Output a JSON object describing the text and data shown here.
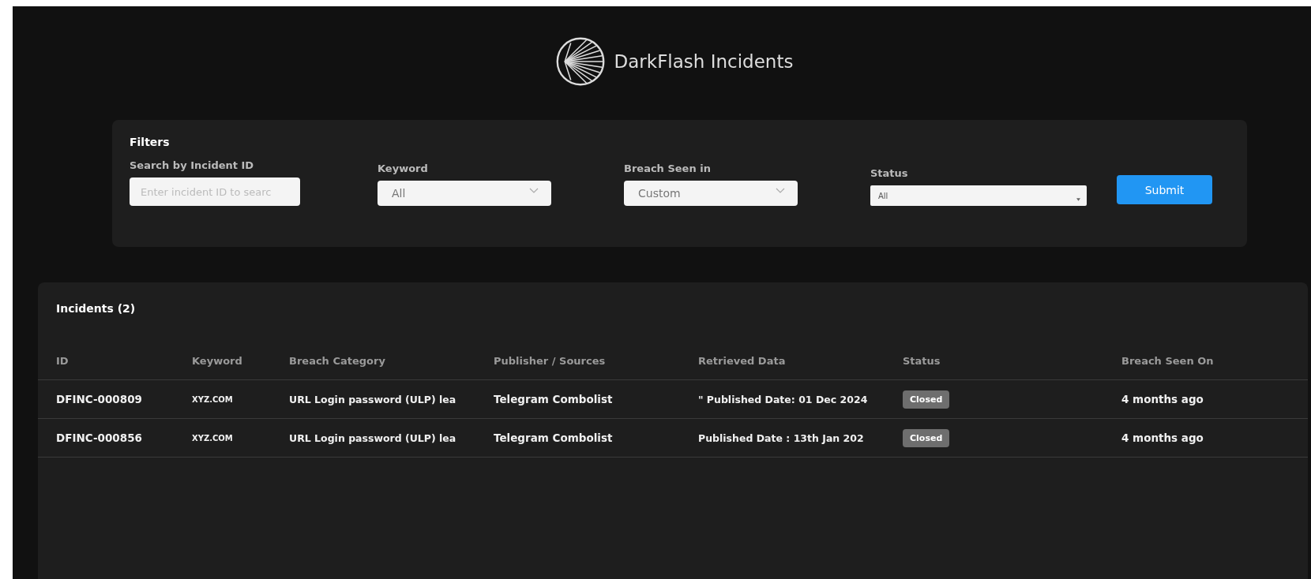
{
  "header": {
    "title": "DarkFlash Incidents"
  },
  "filters": {
    "title": "Filters",
    "fields": [
      {
        "kind": "text",
        "label": "Search by Incident ID",
        "placeholder": "Enter incident ID to searc"
      },
      {
        "kind": "select",
        "label": "Keyword",
        "value": "All"
      },
      {
        "kind": "select",
        "label": "Breach Seen in",
        "value": "Custom"
      },
      {
        "kind": "small-select",
        "label": "Status",
        "value": "All"
      }
    ],
    "submit": "Submit"
  },
  "incidents": {
    "title": "Incidents (2)",
    "columns": [
      "ID",
      "Keyword",
      "Breach Category",
      "Publisher / Sources",
      "Retrieved Data",
      "Status",
      "Breach Seen On"
    ],
    "rows": [
      {
        "id": "DFINC-000809",
        "keyword": "XYZ.COM",
        "category": "URL Login password (ULP) lea",
        "source": "Telegram Combolist",
        "retrieved": "\" Published Date: 01 Dec 2024",
        "status": "Closed",
        "seen": "4 months ago"
      },
      {
        "id": "DFINC-000856",
        "keyword": "XYZ.COM",
        "category": "URL Login password (ULP) lea",
        "source": "Telegram Combolist",
        "retrieved": "Published Date : 13th Jan 202",
        "status": "Closed",
        "seen": "4 months ago"
      }
    ]
  }
}
